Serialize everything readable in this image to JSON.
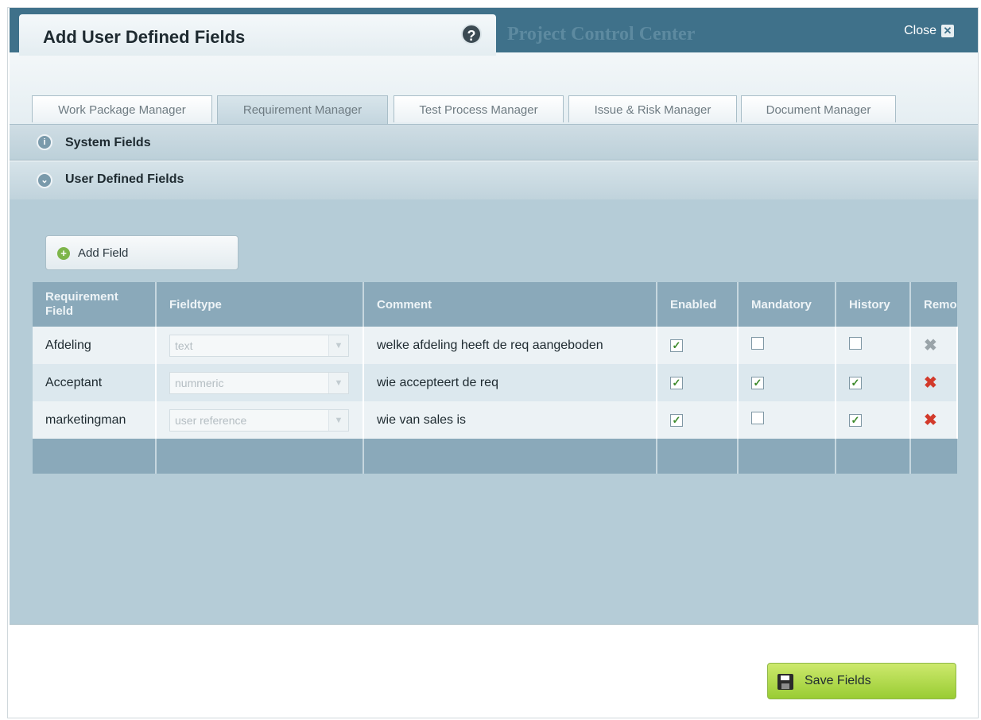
{
  "dialog": {
    "title": "Add User Defined Fields",
    "help_icon": "question-mark-icon",
    "app_name": "Project Control Center",
    "close_label": "Close"
  },
  "tabs": [
    {
      "label": "Work Package Manager",
      "active": false
    },
    {
      "label": "Requirement Manager",
      "active": true
    },
    {
      "label": "Test Process Manager",
      "active": false
    },
    {
      "label": "Issue & Risk Manager",
      "active": false
    },
    {
      "label": "Document Manager",
      "active": false
    }
  ],
  "sections": {
    "system_fields": {
      "label": "System Fields",
      "icon": "info-icon"
    },
    "user_defined_fields": {
      "label": "User Defined Fields",
      "icon": "expand-icon"
    }
  },
  "toolbar": {
    "add_field_label": "Add Field"
  },
  "table": {
    "headers": [
      "Requirement Field",
      "Fieldtype",
      "Comment",
      "Enabled",
      "Mandatory",
      "History",
      "Remo"
    ],
    "rows": [
      {
        "field": "Afdeling",
        "fieldtype": "text",
        "comment": "welke afdeling heeft de req aangeboden",
        "enabled": true,
        "mandatory": false,
        "history": false,
        "removable": false
      },
      {
        "field": "Acceptant",
        "fieldtype": "nummeric",
        "comment": "wie accepteert de req",
        "enabled": true,
        "mandatory": true,
        "history": true,
        "removable": true
      },
      {
        "field": "marketingman",
        "fieldtype": "user reference",
        "comment": "wie van sales is",
        "enabled": true,
        "mandatory": false,
        "history": true,
        "removable": true
      }
    ]
  },
  "footer": {
    "save_label": "Save Fields"
  },
  "colors": {
    "header_bar": "#3f718a",
    "panel": "#b5ccd7",
    "table_header": "#8aa9ba",
    "save_button": "#99cc33",
    "remove_red": "#d23a2b"
  }
}
